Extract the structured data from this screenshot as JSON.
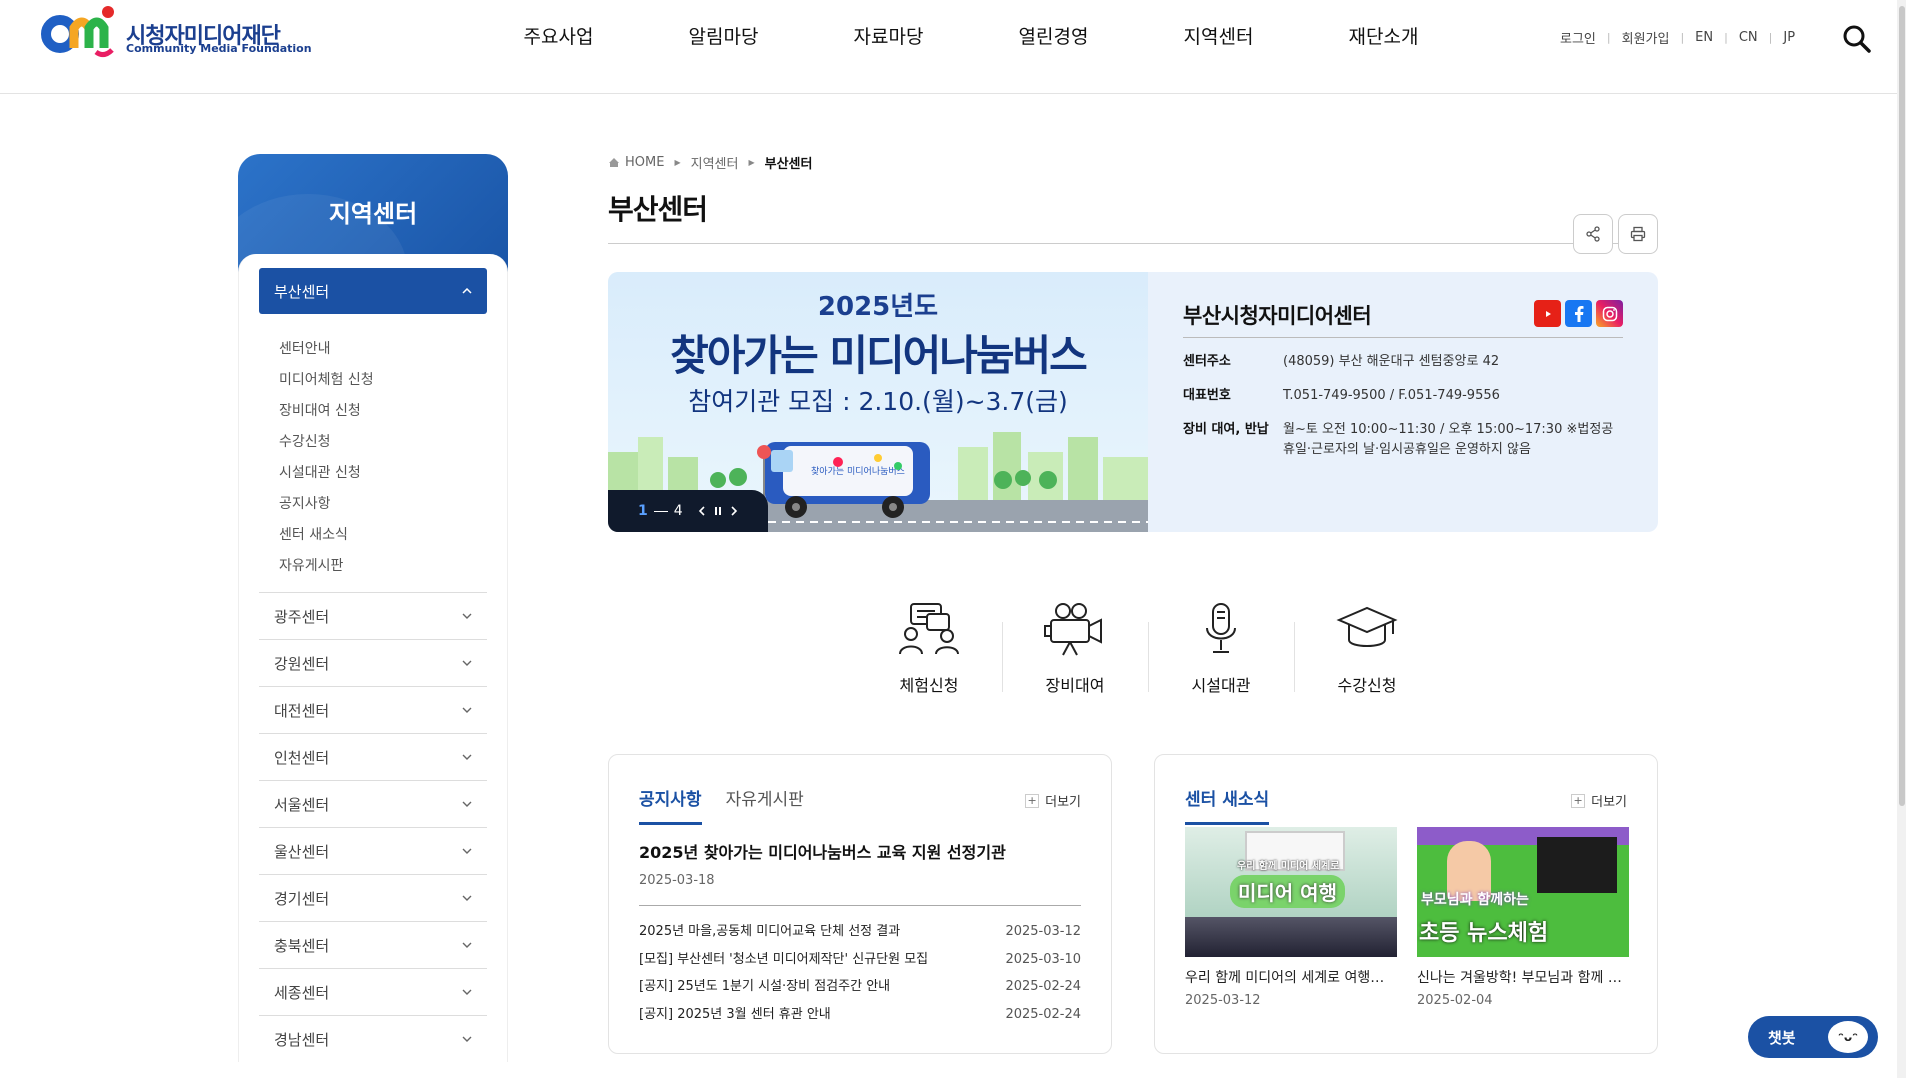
{
  "header": {
    "logo_ko": "시청자미디어재단",
    "logo_en": "Community Media Foundation",
    "gnb": [
      "주요사업",
      "알림마당",
      "자료마당",
      "열린경영",
      "지역센터",
      "재단소개"
    ],
    "util": [
      "로그인",
      "회원가입",
      "EN",
      "CN",
      "JP"
    ]
  },
  "sidebar": {
    "title": "지역센터",
    "active": "부산센터",
    "sub_items": [
      "센터안내",
      "미디어체험 신청",
      "장비대여 신청",
      "수강신청",
      "시설대관 신청",
      "공지사항",
      "센터 새소식",
      "자유게시판"
    ],
    "items": [
      "광주센터",
      "강원센터",
      "대전센터",
      "인천센터",
      "서울센터",
      "울산센터",
      "경기센터",
      "충북센터",
      "세종센터",
      "경남센터"
    ]
  },
  "breadcrumb": [
    "HOME",
    "지역센터",
    "부산센터"
  ],
  "page_title": "부산센터",
  "banner": {
    "year": "2025년도",
    "title": "찾아가는 미디어나눔버스",
    "subtitle": "참여기관 모집 : 2.10.(월)~3.7(금)",
    "slide_current": "1",
    "slide_total": "4",
    "bus_text": "찾아가는 미디어나눔버스"
  },
  "center_info": {
    "name": "부산시청자미디어센터",
    "rows": [
      {
        "k": "센터주소",
        "v": "(48059) 부산 해운대구 센텀중앙로 42"
      },
      {
        "k": "대표번호",
        "v": "T.051-749-9500 / F.051-749-9556"
      },
      {
        "k": "장비 대여, 반납",
        "v": "월~토 오전 10:00~11:30 / 오후 15:00~17:30 ※법정공휴일·근로자의 날·임시공휴일은 운영하지 않음"
      }
    ]
  },
  "quick_menu": [
    "체험신청",
    "장비대여",
    "시설대관",
    "수강신청"
  ],
  "notice_board": {
    "tabs": [
      "공지사항",
      "자유게시판"
    ],
    "more": "더보기",
    "top_title": "2025년 찾아가는 미디어나눔버스 교육 지원 선정기관",
    "top_date": "2025-03-18",
    "rows": [
      {
        "title": "2025년 마을,공동체 미디어교육 단체 선정 결과",
        "date": "2025-03-12"
      },
      {
        "title": "[모집] 부산센터 '청소년 미디어제작단' 신규단원 모집",
        "date": "2025-03-10"
      },
      {
        "title": "[공지] 25년도 1분기 시설·장비 점검주간 안내",
        "date": "2025-02-24"
      },
      {
        "title": "[공지] 2025년 3월 센터 휴관 안내",
        "date": "2025-02-24"
      }
    ]
  },
  "news_board": {
    "tab": "센터 새소식",
    "more": "더보기",
    "items": [
      {
        "title": "우리 함께 미디어의 세계로 여행을 떠나요",
        "date": "2025-03-12",
        "thumb_text": "미디어 여행",
        "thumb_small": "우리 함께 미디어 세계로"
      },
      {
        "title": "신나는 겨울방학! 부모님과 함께 TV 뉴스체험",
        "date": "2025-02-04",
        "thumb_text": "초등 뉴스체험",
        "thumb_small": "부모님과 함께하는"
      }
    ]
  },
  "chatbot": "챗봇"
}
